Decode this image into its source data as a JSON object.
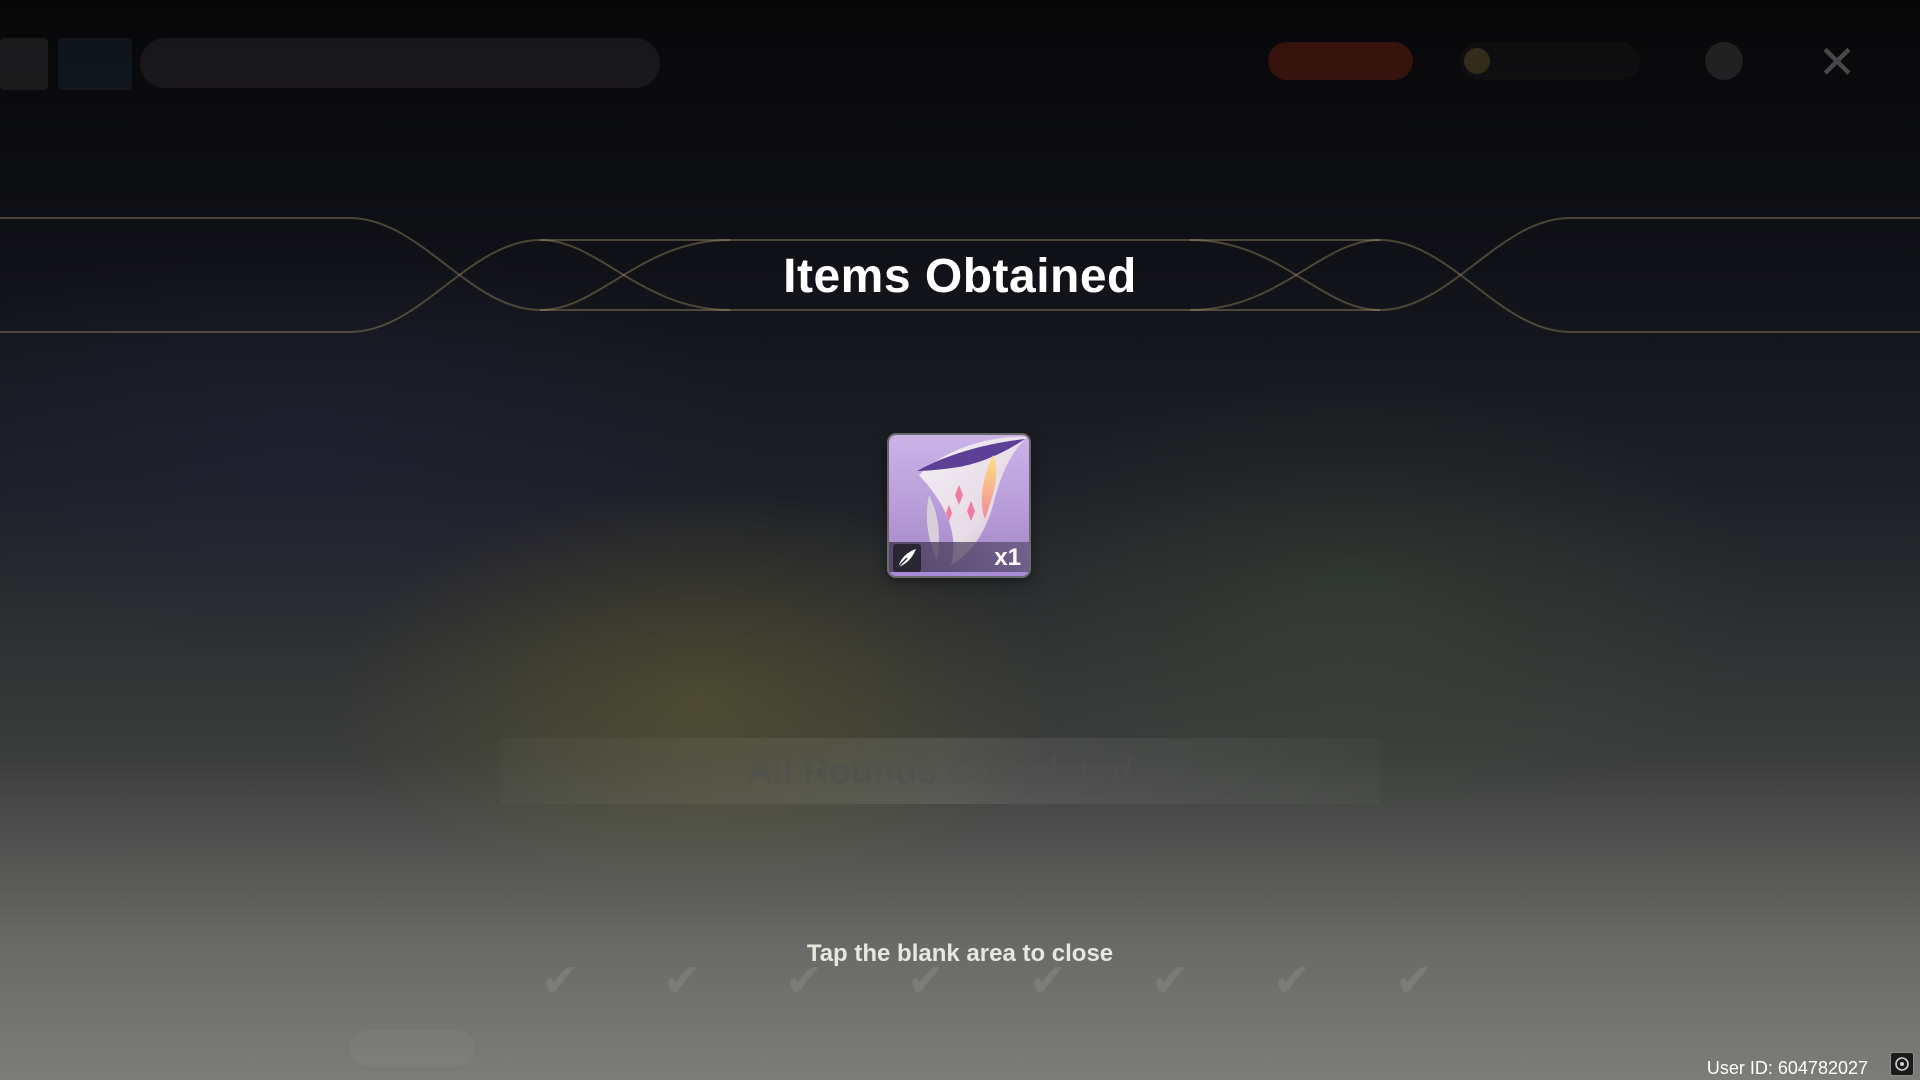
{
  "dialog": {
    "title": "Items Obtained",
    "close_hint": "Tap the blank area to close"
  },
  "items": [
    {
      "name_icon": "feather-icon",
      "quantity": "x1",
      "rarity_color": "#b79bd8"
    }
  ],
  "footer": {
    "user_id": "User ID: 604782027"
  },
  "background": {
    "completed_text": "All Rounds Completed"
  },
  "colors": {
    "title": "#ffffff",
    "hint": "#e8e6df",
    "card_purple": "#b79bd8"
  }
}
